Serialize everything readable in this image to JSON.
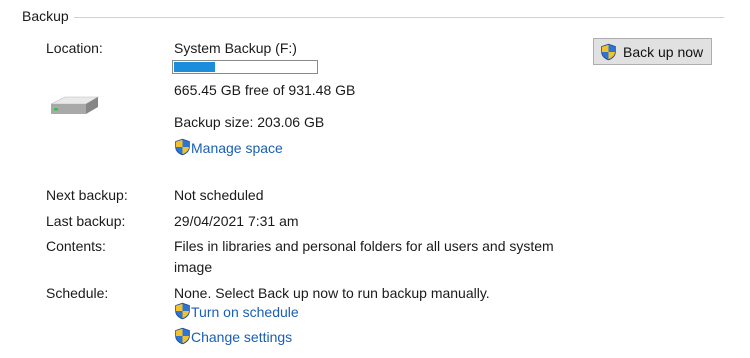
{
  "group": {
    "title": "Backup"
  },
  "location": {
    "label": "Location:",
    "name": "System Backup (F:)",
    "used_fraction": 0.286,
    "free_text": "665.45 GB free of 931.48 GB",
    "backup_size": "Backup size: 203.06 GB",
    "manage_link": "Manage space",
    "drive_icon": "hard-drive-icon"
  },
  "button": {
    "label": "Back up now",
    "icon": "uac-shield-icon"
  },
  "next_backup": {
    "label": "Next backup:",
    "value": "Not scheduled"
  },
  "last_backup": {
    "label": "Last backup:",
    "value": "29/04/2021 7:31 am"
  },
  "contents": {
    "label": "Contents:",
    "line1": "Files in libraries and personal folders for all users and system",
    "line2": "image"
  },
  "schedule": {
    "label": "Schedule:",
    "value": "None. Select Back up now to run backup manually.",
    "turn_on_link": "Turn on schedule",
    "change_link": "Change settings"
  },
  "colors": {
    "link": "#1a5fb4",
    "progress": "#1c8ddb",
    "button_bg": "#e1e1e1"
  }
}
